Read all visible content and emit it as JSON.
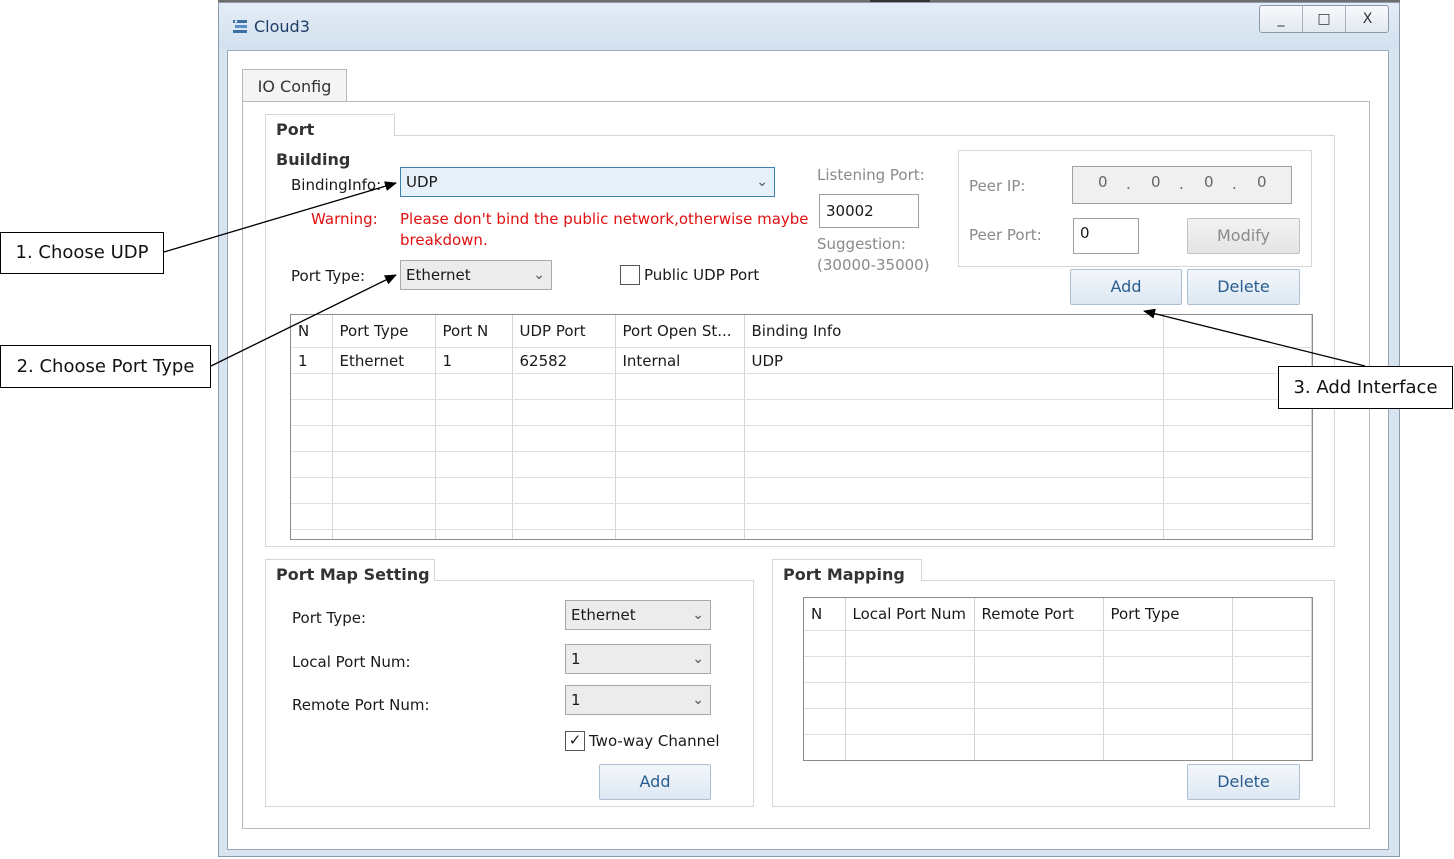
{
  "window": {
    "title": "Cloud3",
    "minimize": "_",
    "maximize": "□",
    "close": "X"
  },
  "tab": {
    "label": "IO Config"
  },
  "port_building": {
    "title": "Port Building",
    "binding_label": "BindingInfo:",
    "binding_value": "UDP",
    "warning_label": "Warning:",
    "warning_text_1": "Please don't bind the public network,otherwise maybe",
    "warning_text_2": "breakdown.",
    "port_type_label": "Port Type:",
    "port_type_value": "Ethernet",
    "public_udp_label": "Public UDP Port",
    "listening_port_label": "Listening Port:",
    "listening_port_value": "30002",
    "suggestion_label": "Suggestion:",
    "suggestion_range": "(30000-35000)",
    "peer_ip_label": "Peer IP:",
    "peer_ip_octets": [
      "0",
      "0",
      "0",
      "0"
    ],
    "peer_port_label": "Peer Port:",
    "peer_port_value": "0",
    "modify_button": "Modify",
    "add_button": "Add",
    "delete_button": "Delete",
    "table": {
      "columns": [
        "N",
        "Port Type",
        "Port N",
        "UDP Port",
        "Port Open St...",
        "Binding Info"
      ],
      "rows": [
        [
          "1",
          "Ethernet",
          "1",
          "62582",
          "Internal",
          "UDP"
        ]
      ]
    }
  },
  "port_map_setting": {
    "title": "Port Map Setting",
    "port_type_label": "Port Type:",
    "port_type_value": "Ethernet",
    "local_port_label": "Local Port Num:",
    "local_port_value": "1",
    "remote_port_label": "Remote Port Num:",
    "remote_port_value": "1",
    "two_way_label": "Two-way Channel",
    "two_way_checked": true,
    "add_button": "Add"
  },
  "port_mapping": {
    "title": "Port Mapping",
    "columns": [
      "N",
      "Local Port Num",
      "Remote Port",
      "Port Type"
    ],
    "delete_button": "Delete"
  },
  "callouts": {
    "step1": "1. Choose UDP",
    "step2": "2. Choose Port Type",
    "step3": "3. Add Interface"
  }
}
